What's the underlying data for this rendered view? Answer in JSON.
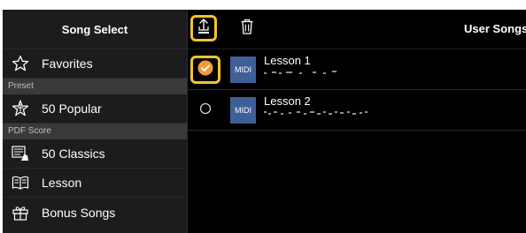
{
  "sidebar": {
    "header": "Song Select",
    "favorites": {
      "label": "Favorites",
      "icon": "star-outline-icon"
    },
    "sections": [
      {
        "title": "Preset",
        "items": [
          {
            "label": "50 Popular",
            "icon": "star-burst-icon"
          }
        ]
      },
      {
        "title": "PDF Score",
        "items": [
          {
            "label": "50 Classics",
            "icon": "score-hand-icon"
          },
          {
            "label": "Lesson",
            "icon": "open-book-icon"
          },
          {
            "label": "Bonus Songs",
            "icon": "gift-icon"
          }
        ]
      }
    ]
  },
  "toolbar": {
    "export_icon": "share-upload-icon",
    "delete_icon": "trash-icon",
    "title": "User Songs"
  },
  "songs": [
    {
      "badge": "MIDI",
      "title": "Lesson 1",
      "selected": true
    },
    {
      "badge": "MIDI",
      "title": "Lesson 2",
      "selected": false
    }
  ],
  "colors": {
    "highlight": "#f2c230",
    "check": "#f29a3b",
    "midi": "#3f5f98",
    "background": "#000000",
    "sidebar": "#1c1c1e"
  }
}
